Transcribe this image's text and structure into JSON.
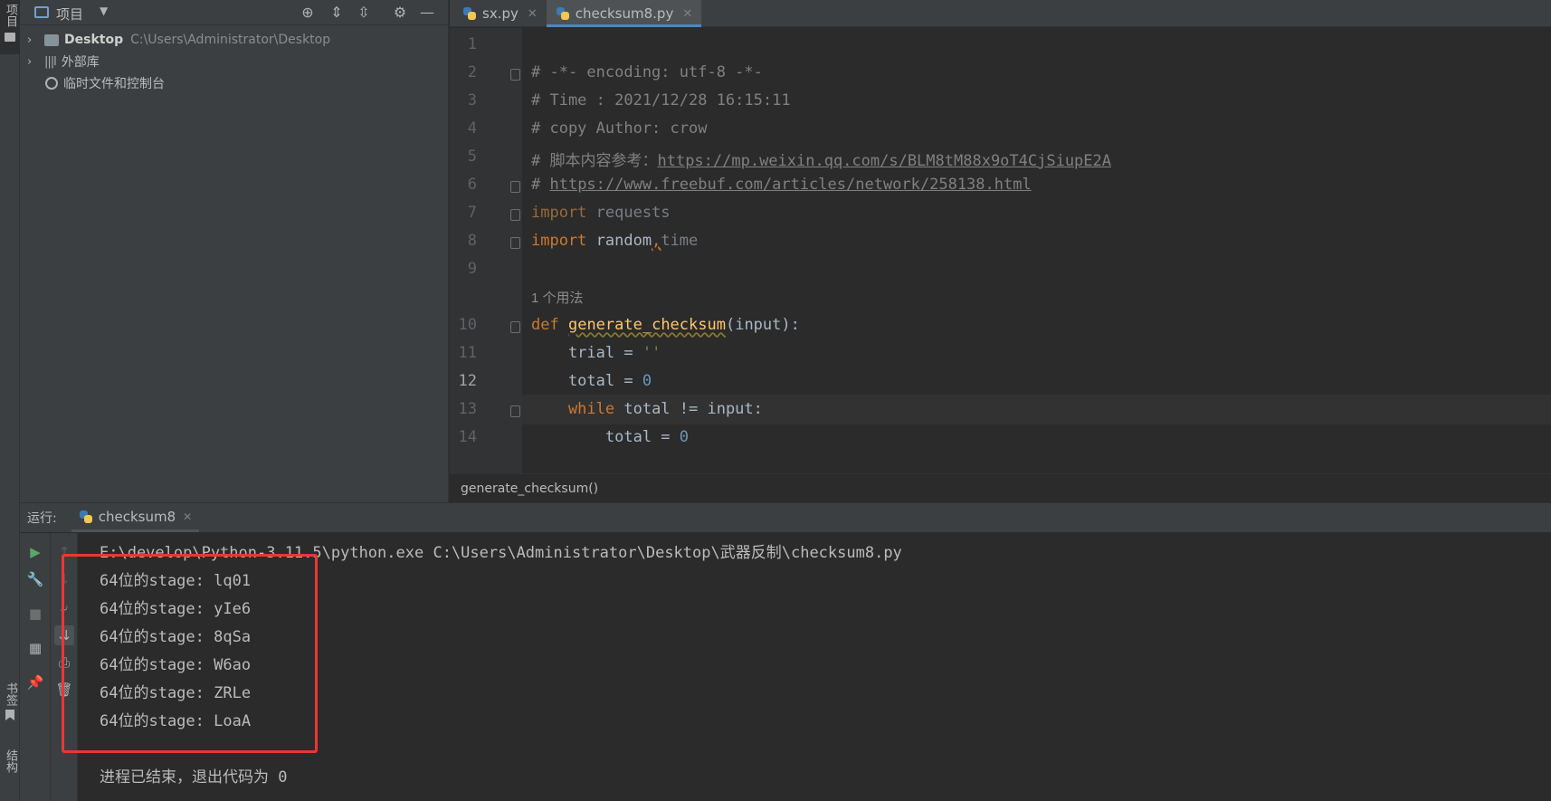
{
  "left_strip": {
    "top_tab": "项目",
    "bottom_tabs": [
      "书签",
      "结构"
    ]
  },
  "project": {
    "title": "项目",
    "tree": [
      {
        "name": "Desktop",
        "path": "C:\\Users\\Administrator\\Desktop",
        "icon": "folder-icon"
      },
      {
        "name": "外部库",
        "icon": "library-icon"
      },
      {
        "name": "临时文件和控制台",
        "icon": "scratches-icon"
      }
    ]
  },
  "editor": {
    "tabs": [
      {
        "label": "sx.py",
        "active": false
      },
      {
        "label": "checksum8.py",
        "active": true
      }
    ],
    "current_line": 12,
    "line_numbers": [
      "1",
      "2",
      "3",
      "4",
      "5",
      "6",
      "7",
      "8",
      "9",
      "10",
      "11",
      "12",
      "13",
      "14"
    ],
    "usage_hint": "1 个用法",
    "code": {
      "l2": "# -*- encoding: utf-8 -*-",
      "l3": "# Time : 2021/12/28 16:15:11",
      "l4": "# copy Author: crow",
      "l5_prefix": "# 脚本内容参考：",
      "l5_link": "https://mp.weixin.qq.com/s/BLM8tM88x9oT4CjSiupE2A",
      "l6_prefix": "# ",
      "l6_link": "https://www.freebuf.com/articles/network/258138.html",
      "l7_kw": "import",
      "l7_rest": " requests",
      "l8_kw": "import",
      "l8_rest": " random",
      "l8_comma": ",",
      "l8_time": "time",
      "l10_kw": "def",
      "l10_fn": "generate_checksum",
      "l10_rest": "(input):",
      "l11_var": "    trial = ",
      "l11_str": "''",
      "l12_var": "    total = ",
      "l12_num": "0",
      "l13_kw": "    while",
      "l13_rest": " total != input:",
      "l14_var": "        total = ",
      "l14_num": "0"
    },
    "breadcrumb": "generate_checksum()"
  },
  "run": {
    "label": "运行:",
    "tab": "checksum8",
    "command": "E:\\develop\\Python-3.11.5\\python.exe C:\\Users\\Administrator\\Desktop\\武器反制\\checksum8.py",
    "output": [
      "64位的stage: lq01",
      "64位的stage: yIe6",
      "64位的stage: 8qSa",
      "64位的stage: W6ao",
      "64位的stage: ZRLe",
      "64位的stage: LoaA"
    ],
    "exit": "进程已结束，退出代码为 0"
  },
  "colors": {
    "highlight_box": "#e53935",
    "accent": "#4a88c7"
  }
}
